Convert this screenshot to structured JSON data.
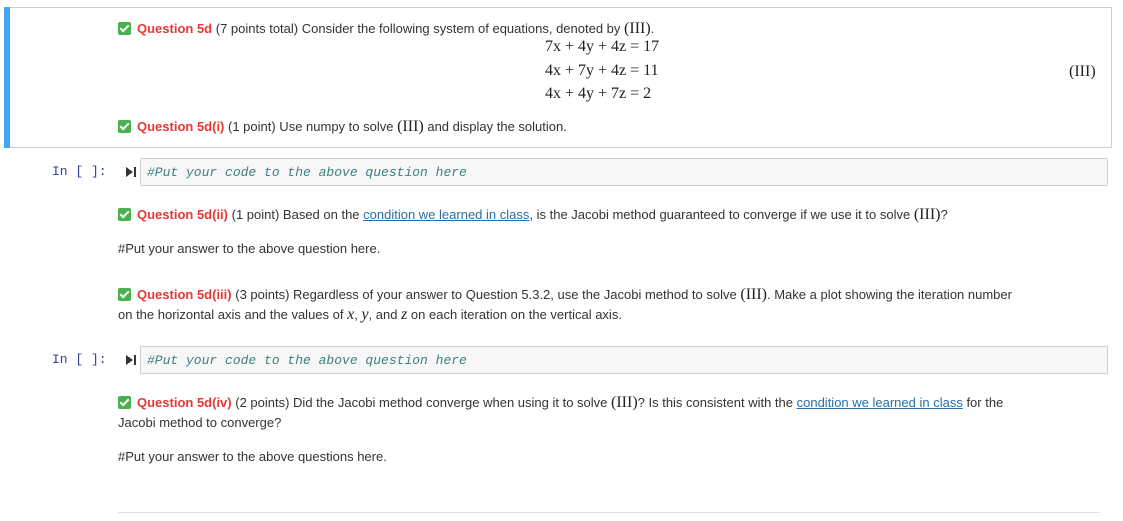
{
  "q5d": {
    "label": "Question 5d",
    "text_a": " (7 points total) Consider the following system of equations, denoted by ",
    "sys": "(III)",
    "text_b": ".",
    "equations": [
      "7x + 4y + 4z = 17",
      "4x + 7y + 4z = 11",
      "4x + 4y + 7z = 2"
    ],
    "eq_number": "(III)"
  },
  "q5di": {
    "label": "Question 5d(i)",
    "text_a": " (1 point) Use numpy to solve ",
    "sys": "(III)",
    "text_b": " and display the solution."
  },
  "code_cell_1": {
    "prompt": "In [ ]:",
    "code": "#Put your code to the above question here"
  },
  "q5dii": {
    "label": "Question 5d(ii)",
    "text_a": " (1 point) Based on the ",
    "link": "condition we learned in class",
    "text_b": ", is the Jacobi method guaranteed to converge if we use it to solve ",
    "sys": "(III)",
    "text_c": "?",
    "answer": "#Put your answer to the above question here."
  },
  "q5diii": {
    "label": "Question 5d(iii)",
    "text_a": " (3 points) Regardless of your answer to Question 5.3.2, use the Jacobi method to solve ",
    "sys": "(III)",
    "text_b": ". Make a plot showing the iteration number",
    "line2_a": "on the horizontal axis and the values of ",
    "x": "x",
    "sep1": ", ",
    "y": "y",
    "sep2": ", and ",
    "z": "z",
    "line2_b": " on each iteration on the vertical axis."
  },
  "code_cell_2": {
    "prompt": "In [ ]:",
    "code": "#Put your code to the above question here"
  },
  "q5div": {
    "label": "Question 5d(iv)",
    "text_a": " (2 points) Did the Jacobi method converge when using it to solve ",
    "sys": "(III)",
    "text_b": "? Is this consistent with the ",
    "link": "condition we learned in class",
    "text_c": " for the",
    "line2": "Jacobi method to converge?",
    "answer": "#Put your answer to the above questions here."
  }
}
